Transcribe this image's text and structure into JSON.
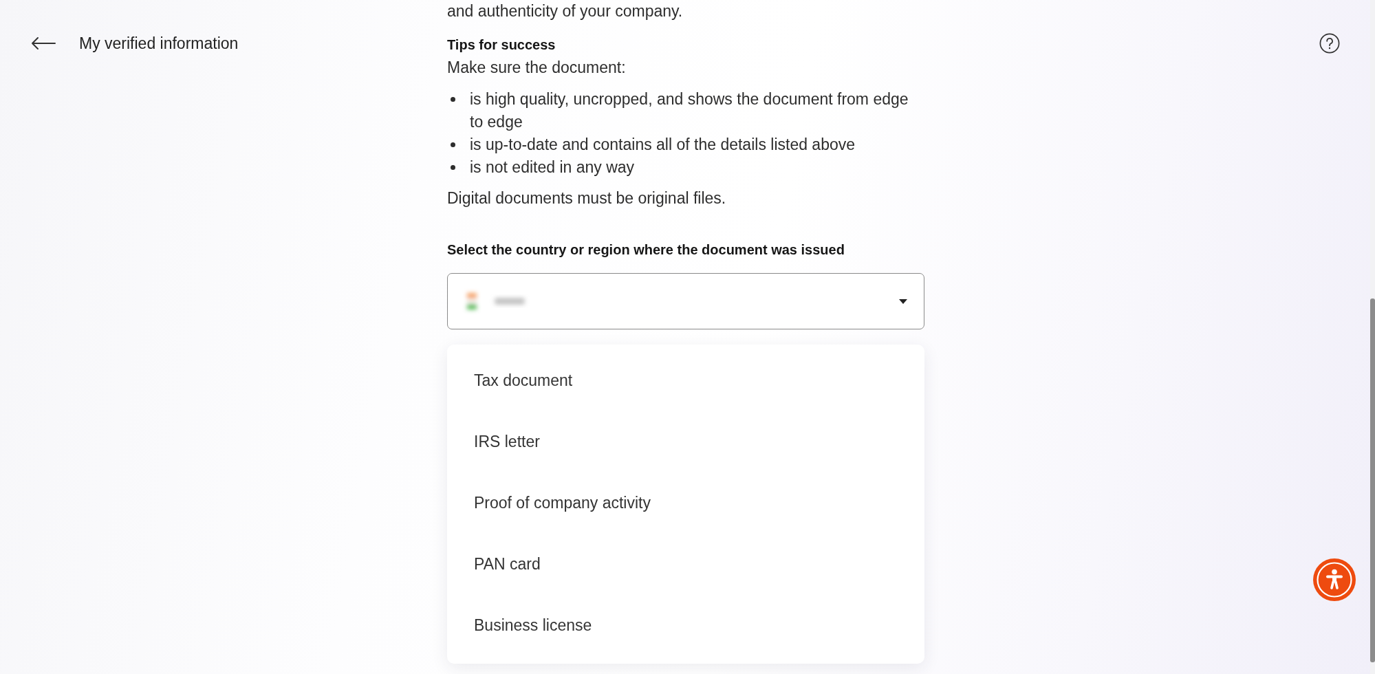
{
  "header": {
    "title": "My verified information"
  },
  "intro": {
    "text": "and authenticity of your company."
  },
  "tips": {
    "title": "Tips for success",
    "lead": "Make sure the document:",
    "items": [
      "is high quality, uncropped, and shows the document from edge to edge",
      "is up-to-date and contains all of the details listed above",
      "is not edited in any way"
    ],
    "note": "Digital documents must be original files."
  },
  "country_select": {
    "label": "Select the country or region where the document was issued"
  },
  "document_type_menu": {
    "options": [
      {
        "label": "Tax document",
        "selected": false
      },
      {
        "label": "IRS letter",
        "selected": false
      },
      {
        "label": "Proof of company activity",
        "selected": false
      },
      {
        "label": "PAN card",
        "selected": false
      },
      {
        "label": "Business license",
        "selected": false
      }
    ]
  }
}
